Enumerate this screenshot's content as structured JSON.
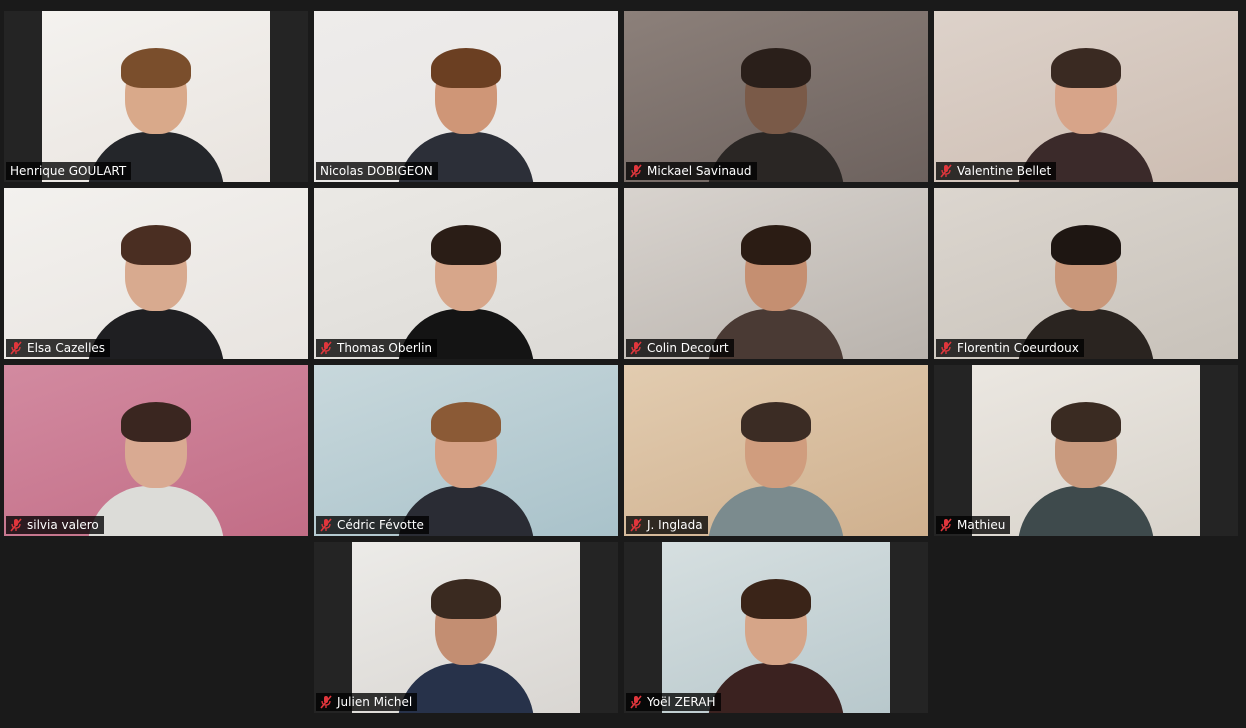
{
  "participants": [
    {
      "name": "Henrique GOULART",
      "muted": false,
      "active": false,
      "bg": "#e9e4df",
      "wall": "#f4f2ef",
      "skin": "#d9a98a",
      "hair": "#7a4e2c",
      "shirt": "#24262a",
      "letterbox": true
    },
    {
      "name": "Nicolas DOBIGEON",
      "muted": false,
      "active": true,
      "bg": "#e7e5e3",
      "wall": "#eeeceb",
      "skin": "#cf9677",
      "hair": "#6b3f22",
      "shirt": "#2c2f38",
      "letterbox": false
    },
    {
      "name": "Mickael Savinaud",
      "muted": true,
      "active": false,
      "bg": "#6d625e",
      "wall": "#8c807a",
      "skin": "#7a5a48",
      "hair": "#2a1f1a",
      "shirt": "#2a2624",
      "letterbox": false
    },
    {
      "name": "Valentine Bellet",
      "muted": true,
      "active": false,
      "bg": "#cdbdb2",
      "wall": "#ddd2ca",
      "skin": "#d7a489",
      "hair": "#3a2a22",
      "shirt": "#3b2a2a",
      "letterbox": false
    },
    {
      "name": "Elsa Cazelles",
      "muted": true,
      "active": false,
      "bg": "#e8e4e0",
      "wall": "#f3f1ee",
      "skin": "#d8aa8f",
      "hair": "#4a2e22",
      "shirt": "#1f1f22",
      "letterbox": false
    },
    {
      "name": "Thomas Oberlin",
      "muted": true,
      "active": false,
      "bg": "#dcdad6",
      "wall": "#ebe9e5",
      "skin": "#d7a68a",
      "hair": "#2a1d16",
      "shirt": "#141414",
      "letterbox": false
    },
    {
      "name": "Colin Decourt",
      "muted": true,
      "active": false,
      "bg": "#b9b3ad",
      "wall": "#d8d3ce",
      "skin": "#c58f71",
      "hair": "#2b1c14",
      "shirt": "#4a3a34",
      "letterbox": false
    },
    {
      "name": "Florentin Coeurdoux",
      "muted": true,
      "active": false,
      "bg": "#c8c2ba",
      "wall": "#dcd6cf",
      "skin": "#c9977a",
      "hair": "#1e1612",
      "shirt": "#2a2420",
      "letterbox": false
    },
    {
      "name": "silvia valero",
      "muted": true,
      "active": false,
      "bg": "#c26d86",
      "wall": "#d28aa0",
      "skin": "#d9aa92",
      "hair": "#3a2620",
      "shirt": "#dcdcd8",
      "letterbox": false
    },
    {
      "name": "Cédric Févotte",
      "muted": true,
      "active": false,
      "bg": "#a9c2ca",
      "wall": "#c8d8dc",
      "skin": "#d5a084",
      "hair": "#8b5a36",
      "shirt": "#2a2c34",
      "letterbox": false
    },
    {
      "name": "J. Inglada",
      "muted": true,
      "active": false,
      "bg": "#cfb08e",
      "wall": "#e2ccb0",
      "skin": "#d09d7e",
      "hair": "#3b2c24",
      "shirt": "#7b8b8e",
      "letterbox": false
    },
    {
      "name": "Mathieu",
      "muted": true,
      "active": false,
      "bg": "#d8d3cb",
      "wall": "#ebe7e1",
      "skin": "#c99a7e",
      "hair": "#3a2b22",
      "shirt": "#3e4a4c",
      "letterbox": true
    },
    {
      "name": "Julien Michel",
      "muted": true,
      "active": false,
      "bg": "#d9d6d2",
      "wall": "#ecebe8",
      "skin": "#c38e72",
      "hair": "#3a2a20",
      "shirt": "#27324a",
      "letterbox": true
    },
    {
      "name": "Yoël ZERAH",
      "muted": true,
      "active": false,
      "bg": "#b8c8cc",
      "wall": "#d6dfe0",
      "skin": "#d6a588",
      "hair": "#3a2418",
      "shirt": "#3b2220",
      "letterbox": true
    }
  ],
  "colors": {
    "background": "#1a1a1a",
    "active_border": "#d6e65a",
    "muted_icon": "#e0363c"
  }
}
